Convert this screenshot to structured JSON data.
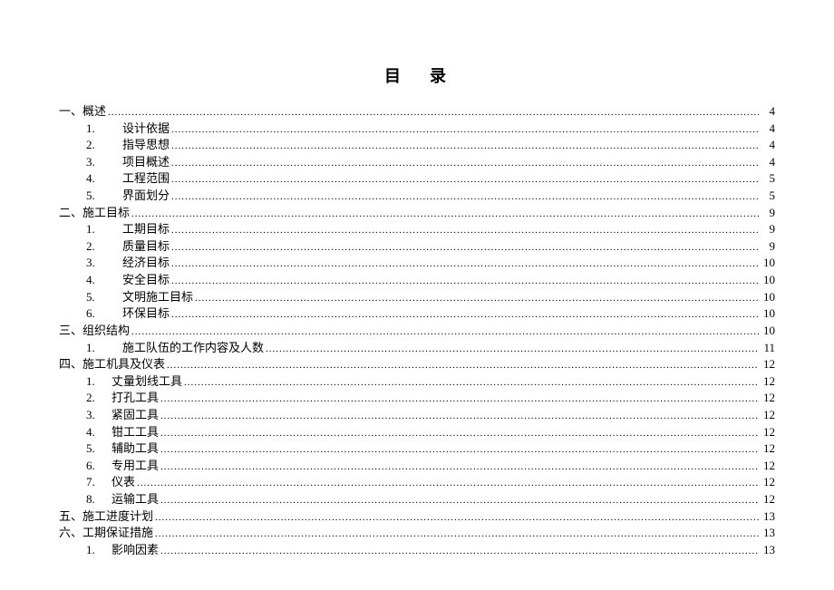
{
  "title_char1": "目",
  "title_char2": "录",
  "sections": [
    {
      "type": "section",
      "marker": "一、",
      "label": "概述",
      "page": "4"
    },
    {
      "type": "sub",
      "marker": "1.",
      "label": "设计依据",
      "page": "4"
    },
    {
      "type": "sub",
      "marker": "2.",
      "label": "指导思想",
      "page": "4"
    },
    {
      "type": "sub",
      "marker": "3.",
      "label": "项目概述",
      "page": "4"
    },
    {
      "type": "sub",
      "marker": "4.",
      "label": "工程范围",
      "page": "5"
    },
    {
      "type": "sub",
      "marker": "5.",
      "label": "界面划分",
      "page": "5"
    },
    {
      "type": "section",
      "marker": "二、",
      "label": "施工目标",
      "page": "9"
    },
    {
      "type": "sub",
      "marker": "1.",
      "label": "工期目标",
      "page": "9"
    },
    {
      "type": "sub",
      "marker": "2.",
      "label": "质量目标",
      "page": "9"
    },
    {
      "type": "sub",
      "marker": "3.",
      "label": "经济目标",
      "page": "10"
    },
    {
      "type": "sub",
      "marker": "4.",
      "label": "安全目标",
      "page": "10"
    },
    {
      "type": "sub",
      "marker": "5.",
      "label": "文明施工目标",
      "page": "10"
    },
    {
      "type": "sub",
      "marker": "6.",
      "label": "环保目标",
      "page": "10"
    },
    {
      "type": "section",
      "marker": "三、",
      "label": "组织结构",
      "page": "10"
    },
    {
      "type": "sub",
      "marker": "1.",
      "label": "施工队伍的工作内容及人数",
      "page": "11"
    },
    {
      "type": "section",
      "marker": "四、",
      "label": "施工机具及仪表",
      "page": "12"
    },
    {
      "type": "sub2",
      "marker": "1.",
      "label": "丈量划线工具",
      "page": "12"
    },
    {
      "type": "sub2",
      "marker": "2.",
      "label": "打孔工具",
      "page": "12"
    },
    {
      "type": "sub2",
      "marker": "3.",
      "label": "紧固工具",
      "page": "12"
    },
    {
      "type": "sub2",
      "marker": "4.",
      "label": "钳工工具",
      "page": "12"
    },
    {
      "type": "sub2",
      "marker": "5.",
      "label": "辅助工具",
      "page": "12"
    },
    {
      "type": "sub2",
      "marker": "6.",
      "label": "专用工具",
      "page": "12"
    },
    {
      "type": "sub2",
      "marker": "7.",
      "label": "仪表",
      "page": "12"
    },
    {
      "type": "sub2",
      "marker": "8.",
      "label": "运输工具",
      "page": "12"
    },
    {
      "type": "section",
      "marker": "五、",
      "label": "施工进度计划",
      "page": "13"
    },
    {
      "type": "section",
      "marker": "六、",
      "label": "工期保证措施",
      "page": "13"
    },
    {
      "type": "sub2",
      "marker": "1.",
      "label": "影响因素",
      "page": "13"
    }
  ]
}
